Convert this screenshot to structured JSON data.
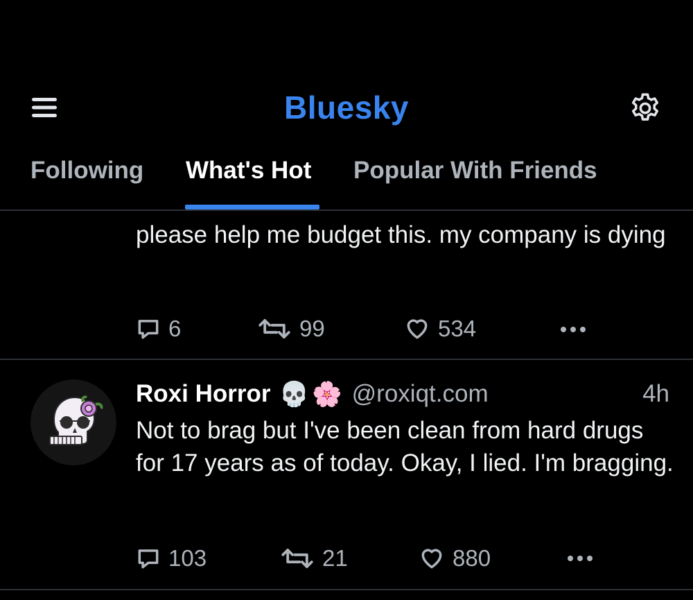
{
  "header": {
    "title": "Bluesky",
    "menu_icon": "hamburger-menu-icon",
    "settings_icon": "gear-icon",
    "accent_color": "#3a84f0"
  },
  "tabs": [
    {
      "label": "Following",
      "active": false
    },
    {
      "label": "What's Hot",
      "active": true
    },
    {
      "label": "Popular With Friends",
      "active": false
    }
  ],
  "feed": {
    "posts": [
      {
        "text": "please help me budget this. my company is dying",
        "replies": "6",
        "reposts": "99",
        "likes": "534"
      },
      {
        "author": "Roxi Horror",
        "emojis": [
          "💀",
          "🌸"
        ],
        "handle": "@roxiqt.com",
        "time": "4h",
        "text": "Not to brag but I've been clean from hard drugs for 17 years as of today. Okay, I lied. I'm bragging.",
        "replies": "103",
        "reposts": "21",
        "likes": "880"
      }
    ]
  }
}
